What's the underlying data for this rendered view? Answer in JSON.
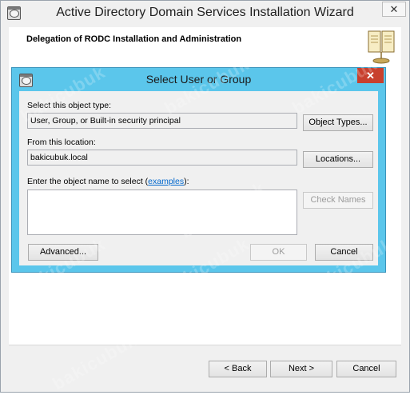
{
  "wizard": {
    "title": "Active Directory Domain Services Installation Wizard",
    "close_glyph": "✕",
    "header_title": "Delegation of RODC Installation and Administration",
    "buttons": {
      "back": "< Back",
      "next": "Next >",
      "cancel": "Cancel"
    }
  },
  "dialog": {
    "title": "Select User or Group",
    "close_glyph": "✕",
    "object_type_label": "Select this object type:",
    "object_type_value": "User, Group, or Built-in security principal",
    "object_types_button": "Object Types...",
    "location_label": "From this location:",
    "location_value": "bakicubuk.local",
    "locations_button": "Locations...",
    "object_name_label": "Enter the object name to select (",
    "examples_link": "examples",
    "object_name_label_end": "):",
    "check_names_button": "Check Names",
    "advanced_button": "Advanced...",
    "ok_button": "OK",
    "cancel_button": "Cancel"
  },
  "watermark": "bakicubuk"
}
